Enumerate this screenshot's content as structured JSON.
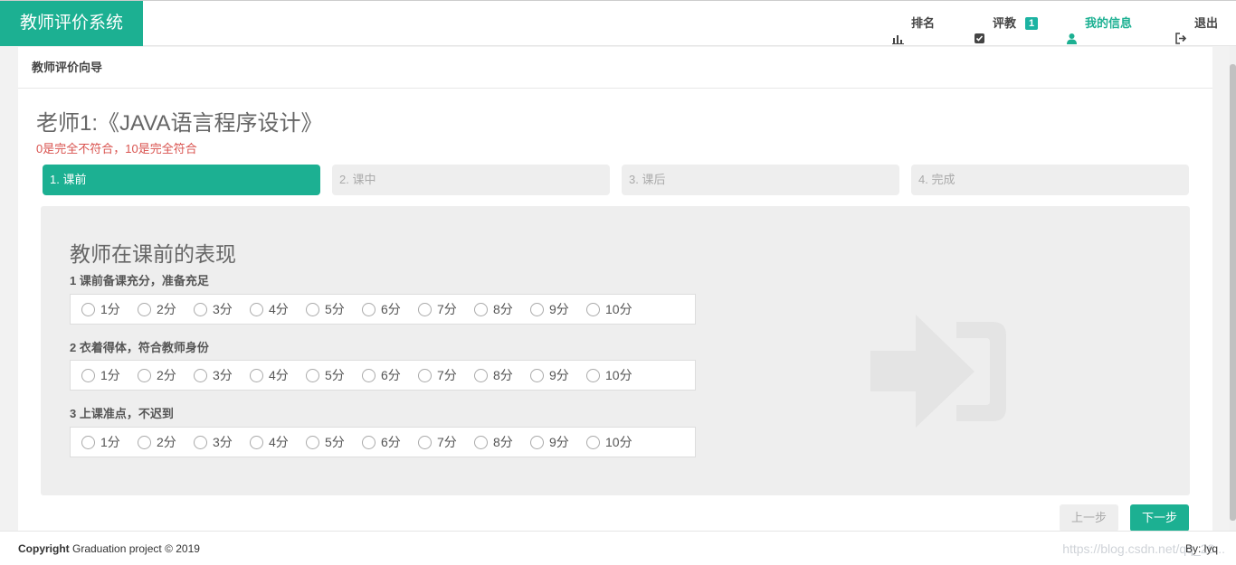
{
  "nav": {
    "brand": "教师评价系统",
    "rank": "排名",
    "evaluate": "评教",
    "evaluate_badge": "1",
    "my_info": "我的信息",
    "logout": "退出"
  },
  "panel": {
    "heading": "教师评价向导",
    "title": "老师1:《JAVA语言程序设计》",
    "hint": "0是完全不符合，10是完全符合"
  },
  "steps": [
    {
      "label": "1. 课前"
    },
    {
      "label": "2. 课中"
    },
    {
      "label": "3. 课后"
    },
    {
      "label": "4. 完成"
    }
  ],
  "section": {
    "title": "教师在课前的表现",
    "questions": [
      {
        "label": "1 课前备课充分，准备充足"
      },
      {
        "label": "2 衣着得体，符合教师身份"
      },
      {
        "label": "3 上课准点，不迟到"
      }
    ],
    "options": [
      "1分",
      "2分",
      "3分",
      "4分",
      "5分",
      "6分",
      "7分",
      "8分",
      "9分",
      "10分"
    ]
  },
  "buttons": {
    "prev": "上一步",
    "next": "下一步"
  },
  "footer": {
    "copyright_bold": "Copyright",
    "copyright_rest": " Graduation project © 2019",
    "by": "By: lyq",
    "watermark": "https://blog.csdn.net/qq_28..."
  },
  "colors": {
    "accent": "#1cb092",
    "hint": "#d9534f"
  }
}
